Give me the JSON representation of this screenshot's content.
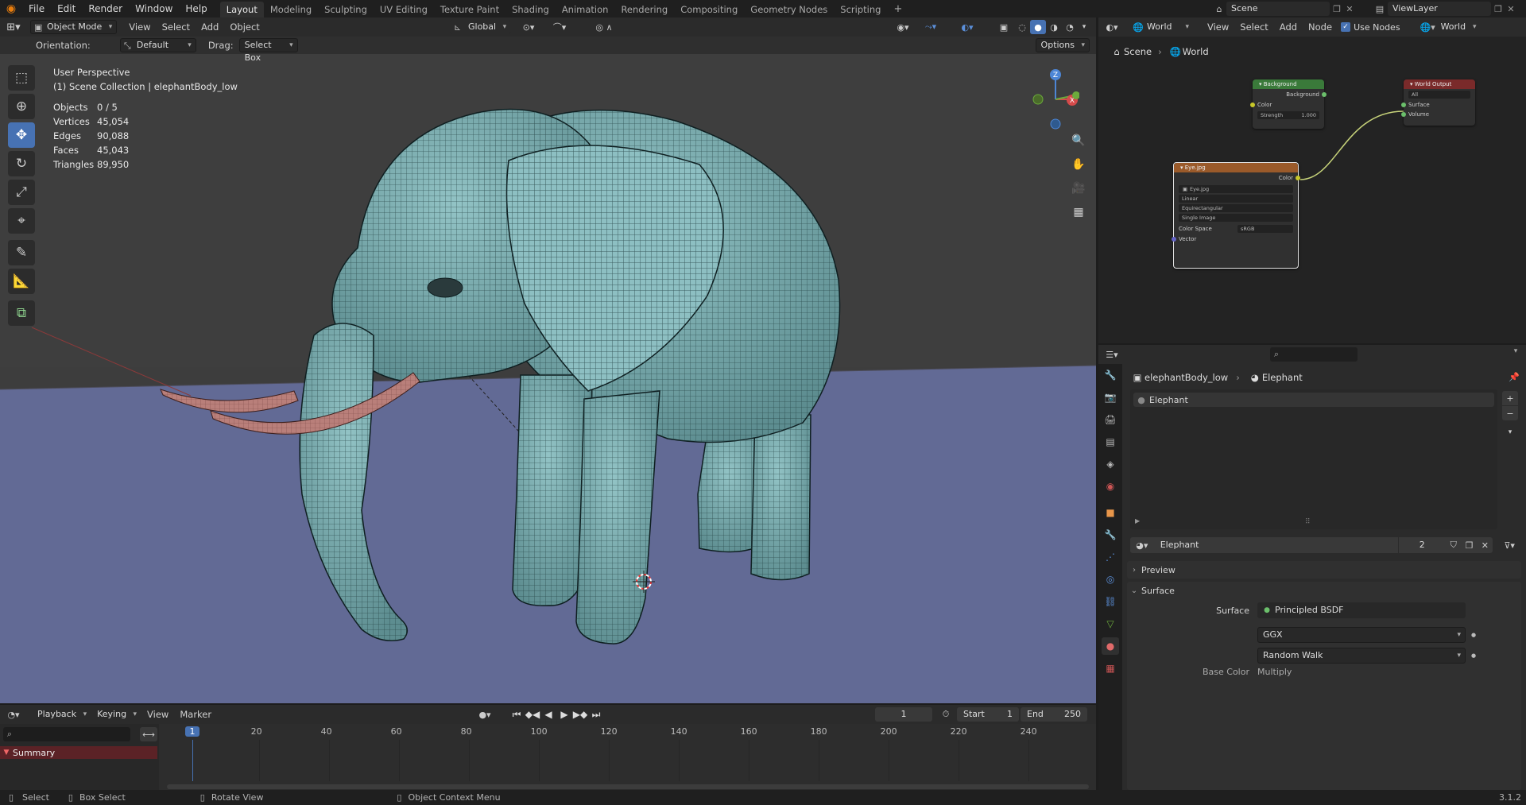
{
  "topbar": {
    "menus": [
      "File",
      "Edit",
      "Render",
      "Window",
      "Help"
    ],
    "workspaces": [
      "Layout",
      "Modeling",
      "Sculpting",
      "UV Editing",
      "Texture Paint",
      "Shading",
      "Animation",
      "Rendering",
      "Compositing",
      "Geometry Nodes",
      "Scripting"
    ],
    "active_workspace": "Layout",
    "scene": "Scene",
    "view_layer": "ViewLayer"
  },
  "viewport": {
    "mode": "Object Mode",
    "menus": [
      "View",
      "Select",
      "Add",
      "Object"
    ],
    "transform": "Global",
    "orientation_label": "Orientation:",
    "orientation": "Default",
    "drag_label": "Drag:",
    "drag": "Select Box",
    "options": "Options",
    "view_name": "User Perspective",
    "collection_line": "(1) Scene Collection | elephantBody_low",
    "stats": [
      {
        "label": "Objects",
        "value": "0 / 5"
      },
      {
        "label": "Vertices",
        "value": "45,054"
      },
      {
        "label": "Edges",
        "value": "90,088"
      },
      {
        "label": "Faces",
        "value": "45,043"
      },
      {
        "label": "Triangles",
        "value": "89,950"
      }
    ],
    "gizmo": {
      "z": "Z",
      "x": "X",
      "y": "Y"
    }
  },
  "timeline": {
    "menus": [
      "Playback",
      "Keying",
      "View",
      "Marker"
    ],
    "current_frame": "1",
    "start_label": "Start",
    "start": "1",
    "end_label": "End",
    "end": "250",
    "ticks": [
      "1",
      "20",
      "40",
      "60",
      "80",
      "100",
      "120",
      "140",
      "160",
      "180",
      "200",
      "220",
      "240"
    ],
    "summary": "Summary"
  },
  "node_editor": {
    "type": "World",
    "menus": [
      "View",
      "Select",
      "Add",
      "Node"
    ],
    "use_nodes_label": "Use Nodes",
    "world": "World",
    "breadcrumb": [
      "Scene",
      "World"
    ],
    "nodes": {
      "background": {
        "title": "Background",
        "out": "Background",
        "color": "Color",
        "strength_label": "Strength",
        "strength": "1.000"
      },
      "world_output": {
        "title": "World Output",
        "target": "All",
        "surface": "Surface",
        "volume": "Volume"
      },
      "image": {
        "title": "Eye.jpg",
        "out": "Color",
        "image": "Eye.jpg",
        "interp": "Linear",
        "projection": "Equirectangular",
        "source": "Single Image",
        "cs_label": "Color Space",
        "cs": "sRGB",
        "vector": "Vector"
      }
    }
  },
  "properties": {
    "breadcrumb": [
      "elephantBody_low",
      "Elephant"
    ],
    "slot": "Elephant",
    "material_name": "Elephant",
    "users": "2",
    "preview_label": "Preview",
    "surface_section": "Surface",
    "surface_label": "Surface",
    "surface_shader": "Principled BSDF",
    "distribution": "GGX",
    "subsurface": "Random Walk",
    "cut_label": "Base Color",
    "cut_value": "Multiply"
  },
  "statusbar": {
    "items": [
      "Select",
      "Box Select",
      "Rotate View",
      "Object Context Menu"
    ],
    "version": "3.1.2"
  },
  "colors": {
    "accent": "#4772b3",
    "mesh": "#7fb0b3",
    "tusk": "#b97f7a",
    "floor": "#626a95"
  }
}
